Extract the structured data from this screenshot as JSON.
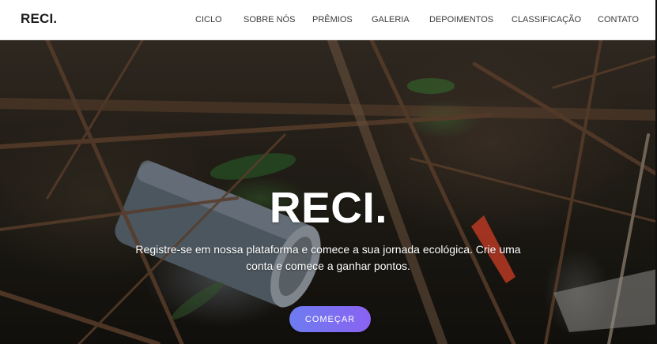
{
  "navbar": {
    "brand": "RECI.",
    "links": [
      "CICLO",
      "SOBRE NÓS",
      "PRÊMIOS",
      "GALERIA",
      "DEPOIMENTOS",
      "CLASSIFICAÇÃO",
      "CONTATO"
    ]
  },
  "hero": {
    "title": "RECI.",
    "text": "Registre-se em nossa plataforma e comece a sua jornada ecológica. Crie uma conta e comece a ganhar pontos.",
    "button_label": "COMEÇAR",
    "background_image": "litter-can-in-dry-grass-photo"
  },
  "colors": {
    "accent_gradient_start": "#6d7cf0",
    "accent_gradient_end": "#8a63f2",
    "navbar_background": "#ffffff",
    "text_primary": "#3a3a3a"
  }
}
